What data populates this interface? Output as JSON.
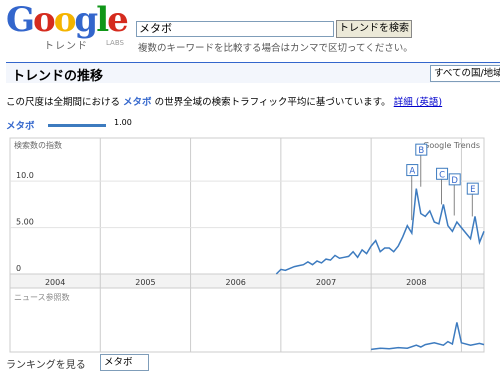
{
  "logo": {
    "word": "Google",
    "sub": "トレンド",
    "labs": "LABS"
  },
  "search": {
    "value": "メタボ",
    "button": "トレンドを検索",
    "hint": "複数のキーワードを比較する場合はカンマで区切ってください。"
  },
  "section": {
    "title": "トレンドの推移",
    "region": "すべての国/地域"
  },
  "description": {
    "before": "この尺度は全期間における",
    "keyword": "メタボ",
    "after": "の世界全域の検索トラフィック平均に基づいています。",
    "link": "詳細 (英語)"
  },
  "legend": {
    "term": "メタボ",
    "value": "1.00"
  },
  "colors": {
    "series": "#3d7bbf",
    "grid": "#cccccc",
    "accent": "#3366cc"
  },
  "chart_data": {
    "type": "line",
    "search_panel": {
      "title": "検索数の指数",
      "source_label": "Google Trends",
      "y_ticks": [
        "0",
        "5.00",
        "10.0"
      ],
      "ylim": [
        0,
        14
      ],
      "x_labels": [
        "2004",
        "2005",
        "2006",
        "2007",
        "2008"
      ],
      "markers": [
        "A",
        "B",
        "C",
        "D",
        "E"
      ],
      "series": [
        {
          "name": "メタボ",
          "x": [
            2006.45,
            2006.5,
            2006.55,
            2006.6,
            2006.65,
            2006.7,
            2006.75,
            2006.8,
            2006.85,
            2006.9,
            2006.95,
            2007.0,
            2007.05,
            2007.1,
            2007.15,
            2007.2,
            2007.25,
            2007.3,
            2007.35,
            2007.4,
            2007.45,
            2007.5,
            2007.55,
            2007.6,
            2007.65,
            2007.7,
            2007.75,
            2007.8,
            2007.85,
            2007.9,
            2007.95,
            2008.0,
            2008.05,
            2008.1,
            2008.15,
            2008.2,
            2008.25,
            2008.3,
            2008.35,
            2008.4,
            2008.45,
            2008.5,
            2008.55,
            2008.6,
            2008.65,
            2008.7,
            2008.75
          ],
          "values": [
            0,
            0.5,
            0.4,
            0.6,
            0.8,
            0.9,
            1.0,
            1.3,
            1.0,
            1.4,
            1.2,
            1.6,
            1.5,
            2.0,
            1.7,
            1.8,
            1.9,
            2.4,
            1.8,
            2.6,
            2.2,
            3.0,
            3.6,
            2.4,
            2.8,
            2.8,
            2.4,
            3.0,
            4.0,
            5.2,
            4.4,
            9.2,
            6.5,
            6.2,
            6.8,
            5.6,
            5.4,
            7.5,
            5.2,
            4.6,
            5.6,
            5.0,
            4.4,
            3.8,
            6.2,
            3.4,
            4.6
          ]
        }
      ]
    },
    "news_panel": {
      "title": "ニュース参照数"
    }
  },
  "ranking": {
    "label": "ランキングを見る",
    "selected": "メタボ"
  }
}
